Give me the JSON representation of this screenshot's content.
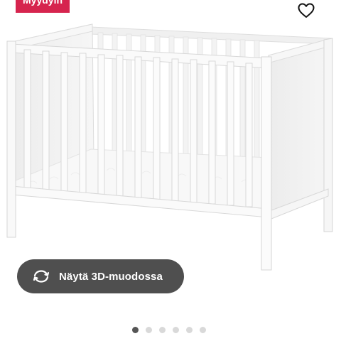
{
  "badge": {
    "label": "Myydyin"
  },
  "icons": {
    "favorite": "heart-outline-icon",
    "rotate": "rotate-360-icon"
  },
  "image": {
    "subject": "crib"
  },
  "view3d": {
    "label": "Näytä 3D-muodossa"
  },
  "carousel": {
    "count": 6,
    "active": 1
  },
  "colors": {
    "badge": "#d6244e",
    "pill": "#4f4f4f",
    "dot_active": "#555555",
    "dot_inactive": "#d9d9d9"
  }
}
